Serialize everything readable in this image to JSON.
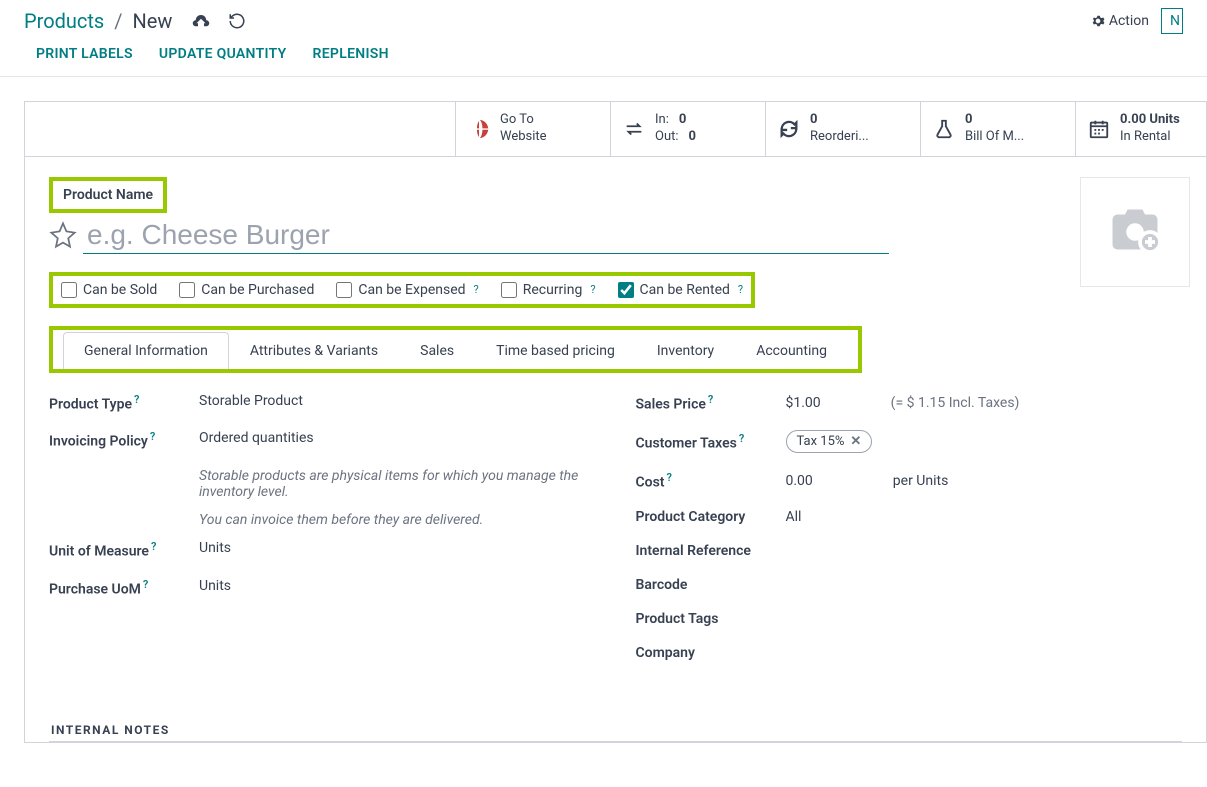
{
  "breadcrumb": {
    "root": "Products",
    "current": "New"
  },
  "header": {
    "action": "Action",
    "next_initial": "N"
  },
  "action_links": [
    "PRINT LABELS",
    "UPDATE QUANTITY",
    "REPLENISH"
  ],
  "smart_buttons": {
    "website": {
      "l1": "Go To",
      "l2": "Website"
    },
    "inout": {
      "in_label": "In:",
      "in_val": "0",
      "out_label": "Out:",
      "out_val": "0"
    },
    "reorder": {
      "val": "0",
      "label": "Reorderi..."
    },
    "bom": {
      "val": "0",
      "label": "Bill Of M..."
    },
    "rental": {
      "val": "0.00 Units",
      "label": "In Rental"
    }
  },
  "product_name_label": "Product Name",
  "product_name_placeholder": "e.g. Cheese Burger",
  "checks": {
    "sold": "Can be Sold",
    "purchased": "Can be Purchased",
    "expensed": "Can be Expensed",
    "recurring": "Recurring",
    "rented": "Can be Rented"
  },
  "tabs": [
    "General Information",
    "Attributes & Variants",
    "Sales",
    "Time based pricing",
    "Inventory",
    "Accounting"
  ],
  "left": {
    "product_type": {
      "label": "Product Type",
      "value": "Storable Product"
    },
    "invoicing_policy": {
      "label": "Invoicing Policy",
      "value": "Ordered quantities"
    },
    "hint1": "Storable products are physical items for which you manage the inventory level.",
    "hint2": "You can invoice them before they are delivered.",
    "uom": {
      "label": "Unit of Measure",
      "value": "Units"
    },
    "puom": {
      "label": "Purchase UoM",
      "value": "Units"
    }
  },
  "right": {
    "sales_price": {
      "label": "Sales Price",
      "value": "$1.00",
      "incl": "(= $ 1.15 Incl. Taxes)"
    },
    "customer_taxes": {
      "label": "Customer Taxes",
      "tag": "Tax 15%"
    },
    "cost": {
      "label": "Cost",
      "value": "0.00",
      "per": "per Units"
    },
    "category": {
      "label": "Product Category",
      "value": "All"
    },
    "internal_ref": {
      "label": "Internal Reference"
    },
    "barcode": {
      "label": "Barcode"
    },
    "tags": {
      "label": "Product Tags"
    },
    "company": {
      "label": "Company"
    }
  },
  "internal_notes": "INTERNAL NOTES"
}
